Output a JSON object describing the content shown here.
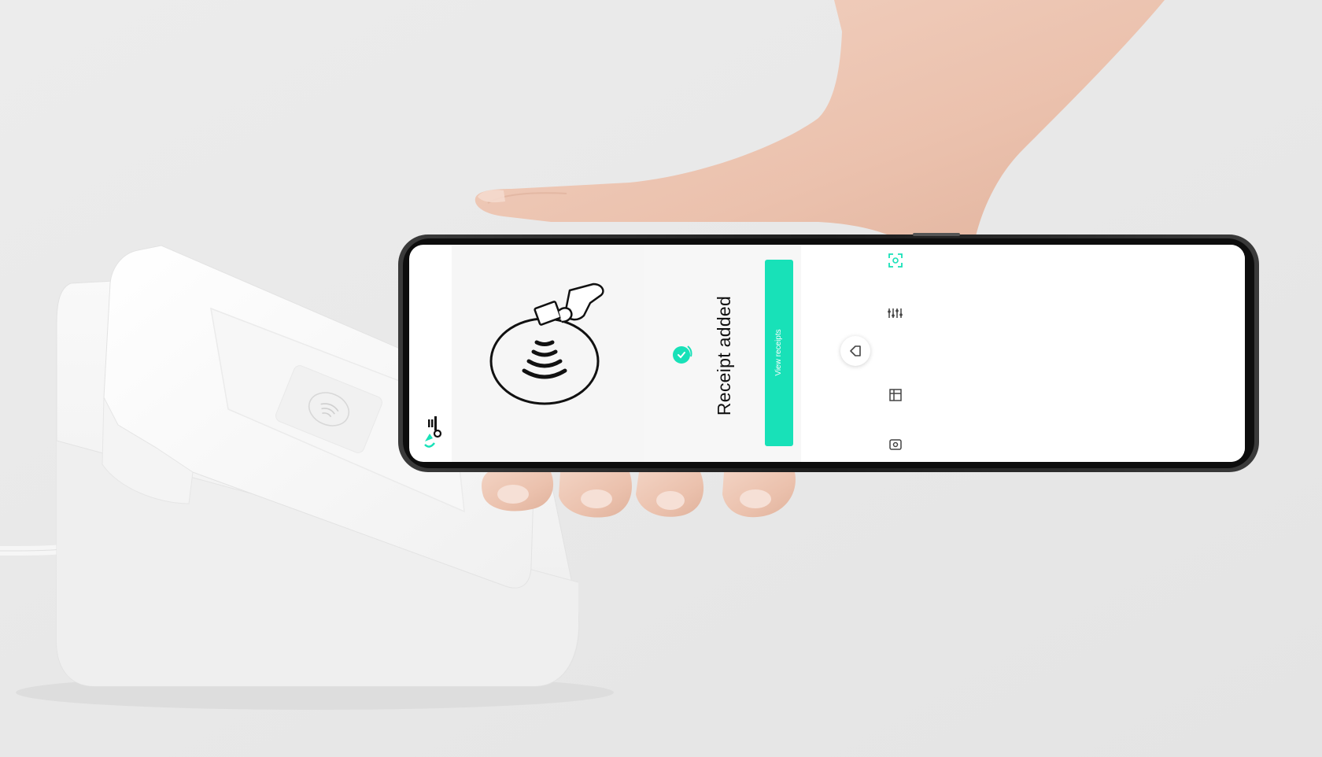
{
  "app": {
    "brand_name": "dijji",
    "accent_color": "#18e1b8"
  },
  "receipt_screen": {
    "title": "Receipt added",
    "status_icon": "check-circle-icon",
    "primary_button_label": "View receipts"
  },
  "illustration": {
    "icon": "contactless-tap-icon"
  },
  "nav": {
    "items": [
      {
        "icon": "scan-icon"
      },
      {
        "icon": "filters-icon"
      },
      {
        "icon": "home-icon",
        "active": true
      },
      {
        "icon": "store-icon"
      },
      {
        "icon": "wallet-icon"
      }
    ]
  }
}
